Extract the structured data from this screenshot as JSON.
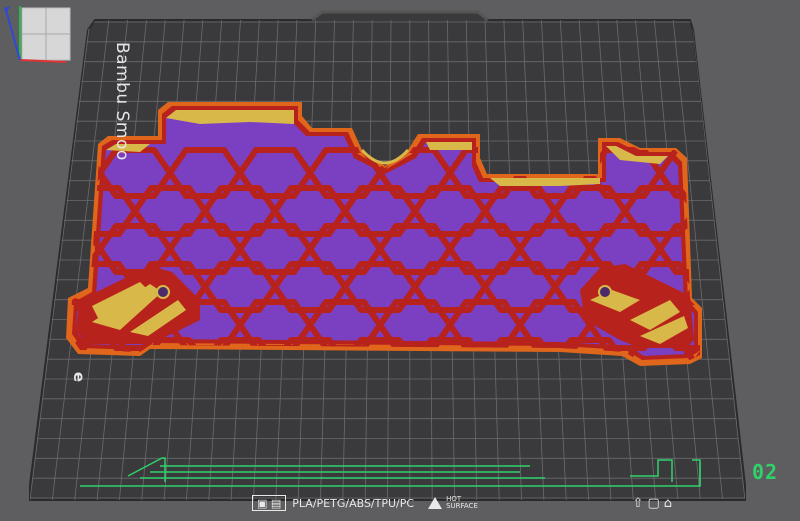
{
  "viewport": {
    "plate_label": "Bambu Smoo",
    "plate_corner_letter": "e",
    "plate_number": "02",
    "bottom_strip": {
      "icons_label": "filament-type-icons",
      "materials_text": "PLA/PETG/ABS/TPU/PC",
      "hot_surface_line1": "HOT",
      "hot_surface_line2": "SURFACE"
    },
    "colors": {
      "background": "#5e5e60",
      "bed": "#3a3a3c",
      "grid": "#6b6b6e",
      "purple_infill": "#7b3fc2",
      "red_wall": "#b8221c",
      "orange_wall": "#e0661c",
      "yellow_skin": "#d9b84a",
      "green_plate_mark": "#2fd16a"
    }
  }
}
